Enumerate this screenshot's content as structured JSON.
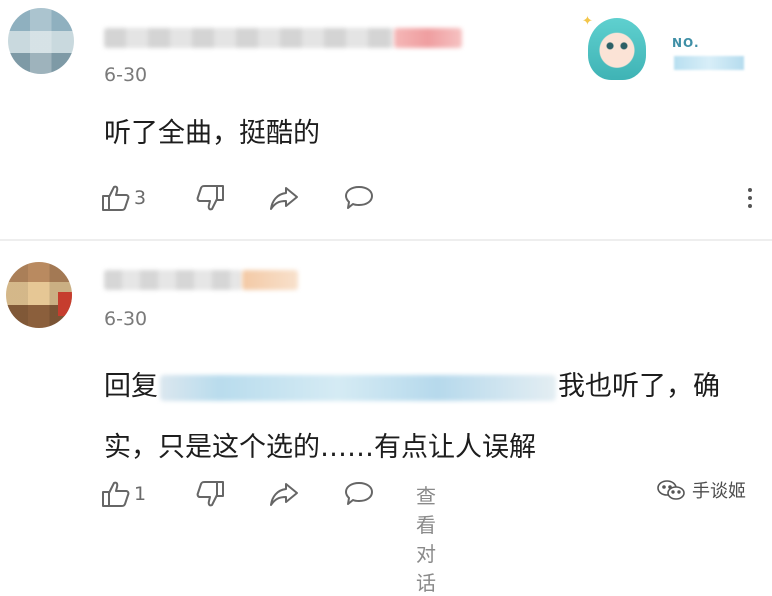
{
  "comments": [
    {
      "date": "6-30",
      "text": "听了全曲，挺酷的",
      "like_count": "3",
      "badge_label": "NO."
    },
    {
      "date": "6-30",
      "reply_prefix": "回复",
      "text": "我也听了，确实，只是这个选的……有点让人误解",
      "like_count": "1",
      "view_conversation": "查看对话"
    }
  ],
  "watermark": {
    "label": "手谈姬"
  },
  "icons": {
    "like": "thumbs-up-icon",
    "dislike": "thumbs-down-icon",
    "share": "share-arrow-icon",
    "reply": "speech-bubble-icon",
    "more": "more-vertical-icon",
    "wechat": "wechat-icon"
  }
}
